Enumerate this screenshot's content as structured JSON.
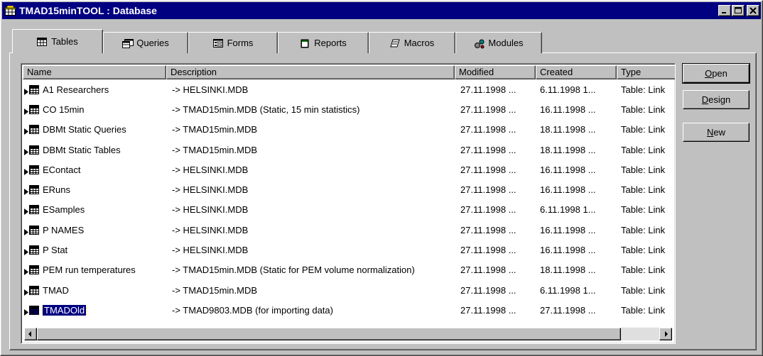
{
  "window": {
    "title": "TMAD15minTOOL : Database",
    "buttons": {
      "minimize": "_",
      "maximize": "□",
      "close": "×"
    }
  },
  "tabs": [
    {
      "label": "Tables",
      "icon": "table-icon",
      "active": true
    },
    {
      "label": "Queries",
      "icon": "query-icon",
      "active": false
    },
    {
      "label": "Forms",
      "icon": "form-icon",
      "active": false
    },
    {
      "label": "Reports",
      "icon": "report-icon",
      "active": false
    },
    {
      "label": "Macros",
      "icon": "macro-icon",
      "active": false
    },
    {
      "label": "Modules",
      "icon": "module-icon",
      "active": false
    }
  ],
  "columns": [
    "Name",
    "Description",
    "Modified",
    "Created",
    "Type"
  ],
  "rows": [
    {
      "name": "A1 Researchers",
      "description": "-> HELSINKI.MDB",
      "modified": "27.11.1998 ...",
      "created": "6.11.1998 1...",
      "type": "Table: Link"
    },
    {
      "name": "CO 15min",
      "description": "-> TMAD15min.MDB (Static, 15 min statistics)",
      "modified": "27.11.1998 ...",
      "created": "16.11.1998 ...",
      "type": "Table: Link"
    },
    {
      "name": "DBMt Static Queries",
      "description": "-> TMAD15min.MDB",
      "modified": "27.11.1998 ...",
      "created": "18.11.1998 ...",
      "type": "Table: Link"
    },
    {
      "name": "DBMt Static Tables",
      "description": "-> TMAD15min.MDB",
      "modified": "27.11.1998 ...",
      "created": "18.11.1998 ...",
      "type": "Table: Link"
    },
    {
      "name": "EContact",
      "description": "-> HELSINKI.MDB",
      "modified": "27.11.1998 ...",
      "created": "16.11.1998 ...",
      "type": "Table: Link"
    },
    {
      "name": "ERuns",
      "description": "-> HELSINKI.MDB",
      "modified": "27.11.1998 ...",
      "created": "16.11.1998 ...",
      "type": "Table: Link"
    },
    {
      "name": "ESamples",
      "description": "-> HELSINKI.MDB",
      "modified": "27.11.1998 ...",
      "created": "6.11.1998 1...",
      "type": "Table: Link"
    },
    {
      "name": "P NAMES",
      "description": "-> HELSINKI.MDB",
      "modified": "27.11.1998 ...",
      "created": "16.11.1998 ...",
      "type": "Table: Link"
    },
    {
      "name": "P Stat",
      "description": "-> HELSINKI.MDB",
      "modified": "27.11.1998 ...",
      "created": "16.11.1998 ...",
      "type": "Table: Link"
    },
    {
      "name": "PEM run temperatures",
      "description": "-> TMAD15min.MDB (Static for PEM volume normalization)",
      "modified": "27.11.1998 ...",
      "created": "18.11.1998 ...",
      "type": "Table: Link"
    },
    {
      "name": "TMAD",
      "description": "-> TMAD15min.MDB",
      "modified": "27.11.1998 ...",
      "created": "6.11.1998 1...",
      "type": "Table: Link"
    },
    {
      "name": "TMADOld",
      "description": "-> TMAD9803.MDB (for importing data)",
      "modified": "27.11.1998 ...",
      "created": "27.11.1998 ...",
      "type": "Table: Link",
      "selected": true
    }
  ],
  "side_buttons": {
    "open": {
      "ul": "O",
      "rest": "pen"
    },
    "design": {
      "ul": "D",
      "rest": "esign"
    },
    "new": {
      "ul": "N",
      "rest": "ew"
    }
  }
}
